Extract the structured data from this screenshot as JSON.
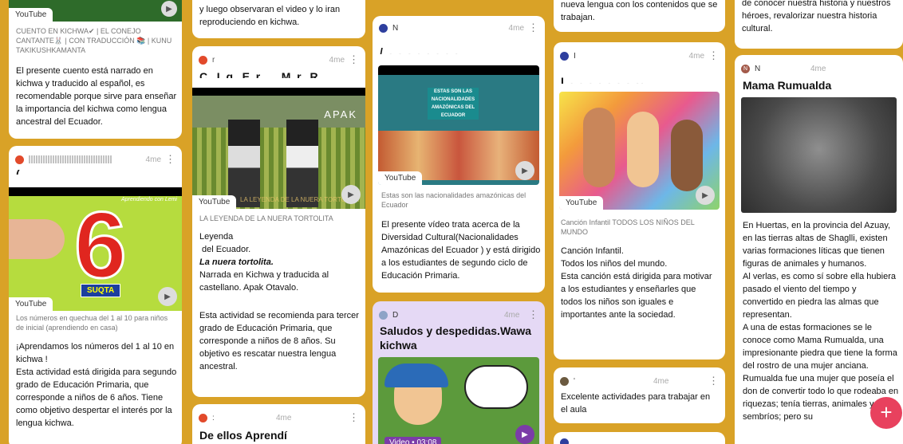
{
  "fab": {
    "label": "+"
  },
  "col1": {
    "card1": {
      "youtube": "YouTube",
      "caption": "CUENTO EN KICHWA✔ | EL CONEJO CANTANTE🐰 | CON TRADUCCIÓN 📚 | KUNU TAKIKUSHKAMANTA",
      "body": "El presente cuento está narrado en kichwa y traducido al español, es recomendable porque sirve para enseñar la importancia del  kichwa como lengua ancestral del Ecuador."
    },
    "card2": {
      "time": "4me",
      "youtube": "YouTube",
      "suqta": "SUQTA",
      "numeral": "6",
      "banner": "Aprendiendo con Lemi",
      "caption": "Los números en quechua del 1 al 10 para niños de inicial (aprendiendo en casa)",
      "body": "¡Aprendamos los números del 1 al 10 en kichwa !\nEsta actividad está dirigida para segundo grado de Educación Primaria, que corresponde a niños de 6 años. Tiene como objetivo despertar el interés por la lengua kichwa."
    }
  },
  "col2": {
    "card1": {
      "body": "y luego observaran el video y lo iran reproduciendo en kichwa."
    },
    "card2": {
      "time": "4me",
      "title": "C.. I..g.. E..r...... M..r.. R....",
      "youtube": "YouTube",
      "apak": "APAK",
      "video_overlay": "LA LEYENDA DE LA NUERA TORTOLITA",
      "caption": "LA LEYENDA DE LA NUERA TORTOLITA",
      "line1": "Leyenda",
      "line2": " del Ecuador.",
      "line3": "La nuera tortolita.",
      "line4": "Narrada en  Kichwa y traducida al castellano. Apak Otavalo.",
      "line5": "Esta actividad  se recomienda para tercer grado de Educación Primaria, que corresponde a niños de 8 años. Su objetivo es rescatar nuestra lengua ancestral."
    },
    "card3": {
      "time": "4me",
      "title": "De ellos Aprendí"
    }
  },
  "col3": {
    "card1": {
      "time": "4me",
      "youtube": "YouTube",
      "thumb_text": "ESTAS SON LAS NACIONALIDADES AMAZÓNICAS DEL ECUADOR",
      "caption": "Estas son las nacionalidades amazónicas del Ecuador",
      "body": "El presente vídeo trata acerca de la Diversidad Cultural(Nacionalidades Amazónicas del Ecuador ) y está dirigido a los estudiantes de segundo ciclo de Educación Primaria."
    },
    "card2": {
      "time": "4me",
      "title": "Saludos y despedidas.Wawa kichwa",
      "video_label": "Video • 03:08"
    }
  },
  "col4": {
    "card1": {
      "body": "nueva lengua con los contenidos que se trabajan."
    },
    "card2": {
      "time": "4me",
      "youtube": "YouTube",
      "caption": "Canción Infantil TODOS LOS NIÑOS DEL MUNDO",
      "line1": "Canción Infantil.",
      "line2": "Todos los niños del mundo.",
      "line3": "Esta canción está dirigida para motivar a los estudiantes y enseñarles que todos los niños son iguales e importantes  ante la sociedad."
    },
    "card3": {
      "time": "4me",
      "body": "Excelente actividades para trabajar en el aula"
    }
  },
  "col5": {
    "card1": {
      "body": "de conocer nuestra historia y nuestros héroes, revalorizar nuestra historia cultural."
    },
    "card2": {
      "initial": "N",
      "time": "4me",
      "title": "Mama Rumualda",
      "body": "En Huertas, en la provincia del Azuay, en las tierras altas de Shaglli, existen varias formaciones líticas que tienen figuras de animales y humanos.\nAl verlas, es como sí sobre ella hubiera pasado el viento del tiempo y convertido en piedra las almas que representan.\nA una de estas formaciones se le conoce como Mama Rumualda, una impresionante piedra que tiene la forma del rostro de una mujer anciana. Rumualda fue una mujer que poseía el don de convertir todo lo que rodeaba en riquezas; tenía tierras, animales y sembríos; pero su"
    }
  }
}
